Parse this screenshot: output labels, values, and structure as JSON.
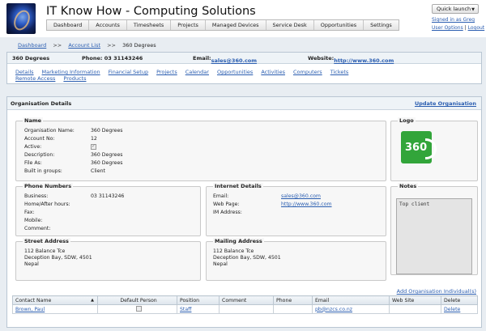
{
  "app": {
    "title": "IT Know How - Computing Solutions",
    "nav": [
      "Dashboard",
      "Accounts",
      "Timesheets",
      "Projects",
      "Managed Devices",
      "Service Desk",
      "Opportunities",
      "Settings"
    ],
    "quick_launch": "Quick launch",
    "signed_in": "Signed in as Greg",
    "user_options": "User Options",
    "logout": "Logout"
  },
  "breadcrumb": [
    "Dashboard",
    "Account List",
    "360 Degrees"
  ],
  "account": {
    "name": "360 Degrees",
    "phone_label": "Phone:",
    "phone": "03 31143246",
    "email_label": "Email:",
    "email": "sales@360.com",
    "website_label": "Website:",
    "website": "http://www.360.com",
    "tabs": [
      "Details",
      "Marketing Information",
      "Financial Setup",
      "Projects",
      "Calendar",
      "Opportunities",
      "Activities",
      "Computers",
      "Tickets",
      "Remote Access",
      "Products"
    ]
  },
  "org": {
    "panel_title": "Organisation Details",
    "update_link": "Update Organisation",
    "name_section": {
      "legend": "Name",
      "fields": [
        {
          "label": "Organisation Name:",
          "value": "360 Degrees"
        },
        {
          "label": "Account No:",
          "value": "12"
        },
        {
          "label": "Active:",
          "value": ""
        },
        {
          "label": "Description:",
          "value": "360 Degrees"
        },
        {
          "label": "File As:",
          "value": "360 Degrees"
        },
        {
          "label": "Built in groups:",
          "value": "Client"
        }
      ]
    },
    "logo_section": {
      "legend": "Logo",
      "logo_text": "360"
    },
    "phone_section": {
      "legend": "Phone Numbers",
      "fields": [
        {
          "label": "Business:",
          "value": "03 31143246"
        },
        {
          "label": "Home/After hours:",
          "value": ""
        },
        {
          "label": "Fax:",
          "value": ""
        },
        {
          "label": "Mobile:",
          "value": ""
        },
        {
          "label": "Comment:",
          "value": ""
        }
      ]
    },
    "internet_section": {
      "legend": "Internet Details",
      "fields": [
        {
          "label": "Email:",
          "value": "sales@360.com"
        },
        {
          "label": "Web Page:",
          "value": "http://www.360.com"
        },
        {
          "label": "IM Address:",
          "value": ""
        }
      ]
    },
    "notes_section": {
      "legend": "Notes",
      "text": "Top client"
    },
    "street_section": {
      "legend": "Street Address",
      "lines": [
        "112 Balance Tce",
        "Deception Bay, SDW, 4501",
        "Nepal"
      ]
    },
    "mailing_section": {
      "legend": "Mailing Address",
      "lines": [
        "112 Balance Tce",
        "Deception Bay, SDW, 4501",
        "Nepal"
      ]
    },
    "add_individual": "Add Organisation Individual(s)",
    "contacts": {
      "headers": [
        "Contact Name",
        "Default Person",
        "Position",
        "Comment",
        "Phone",
        "Email",
        "Web Site",
        "Delete"
      ],
      "rows": [
        {
          "name": "Brown, Paul",
          "position": "Staff",
          "comment": "",
          "phone": "",
          "email": "pb@nzcs.co.nz",
          "website": "",
          "delete": "Delete"
        }
      ]
    }
  },
  "colors": {
    "link": "#2a5db0",
    "logo_green": "#32a53a",
    "panel_header": "#eef3f7"
  }
}
